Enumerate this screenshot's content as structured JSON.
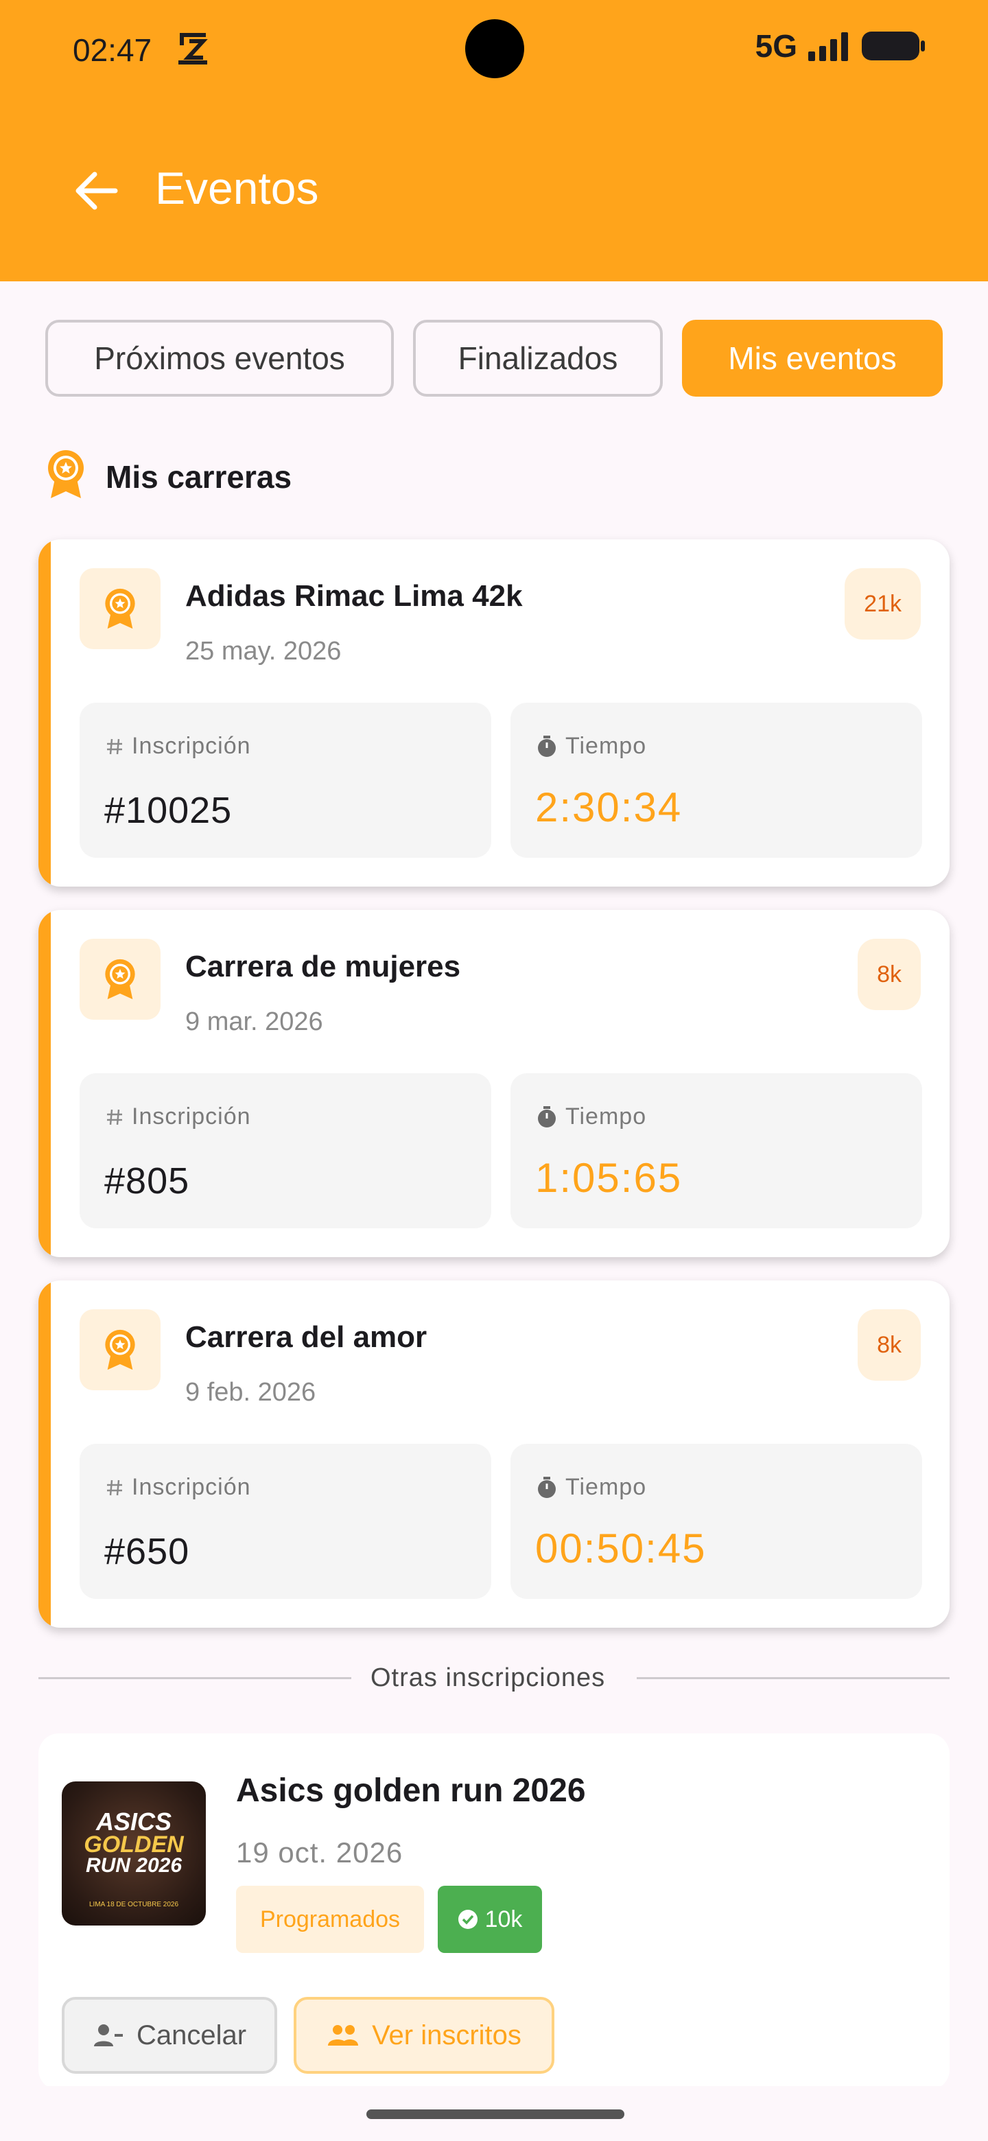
{
  "status_bar": {
    "time": "02:47",
    "network": "5G"
  },
  "header": {
    "title": "Eventos"
  },
  "tabs": [
    {
      "label": "Próximos eventos",
      "active": false
    },
    {
      "label": "Finalizados",
      "active": false
    },
    {
      "label": "Mis eventos",
      "active": true
    }
  ],
  "section": {
    "title": "Mis carreras"
  },
  "races": [
    {
      "name": "Adidas Rimac Lima 42k",
      "date": "25 may. 2026",
      "distance": "21k",
      "inscripcion_label": "Inscripción",
      "inscripcion": "#10025",
      "tiempo_label": "Tiempo",
      "tiempo": "2:30:34"
    },
    {
      "name": "Carrera de mujeres",
      "date": "9 mar. 2026",
      "distance": "8k",
      "inscripcion_label": "Inscripción",
      "inscripcion": "#805",
      "tiempo_label": "Tiempo",
      "tiempo": "1:05:65"
    },
    {
      "name": "Carrera del amor",
      "date": "9 feb. 2026",
      "distance": "8k",
      "inscripcion_label": "Inscripción",
      "inscripcion": "#650",
      "tiempo_label": "Tiempo",
      "tiempo": "00:50:45"
    }
  ],
  "divider": {
    "label": "Otras inscripciones"
  },
  "other_registration": {
    "name": "Asics golden run 2026",
    "date": "19 oct. 2026",
    "status": "Programados",
    "distance": "10k",
    "thumbnail": {
      "line1": "ASICS",
      "line2": "GOLDEN",
      "line3": "RUN 2026",
      "line4": "LIMA 18 DE OCTUBRE 2026"
    },
    "cancel_label": "Cancelar",
    "inscritos_label": "Ver inscritos"
  },
  "colors": {
    "accent": "#FFA41B",
    "accent_soft": "#FFF1DC",
    "success": "#4CAF50",
    "distance_text": "#E0620F"
  }
}
